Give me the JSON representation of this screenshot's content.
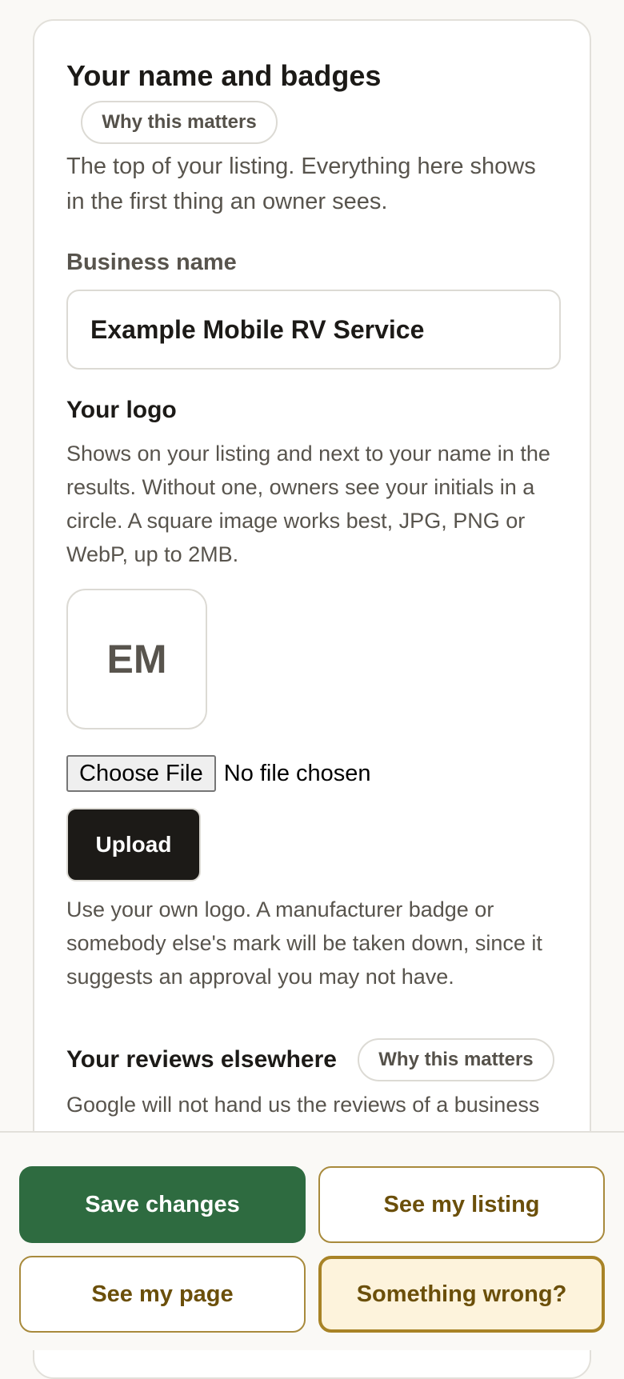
{
  "identity": {
    "title": "Your name and badges",
    "why_label": "Why this matters",
    "intro": "The top of your listing. Everything here shows in the first thing an owner sees."
  },
  "business_name": {
    "label": "Business name",
    "value": "Example Mobile RV Service"
  },
  "logo": {
    "title": "Your logo",
    "description": "Shows on your listing and next to your name in the results. Without one, owners see your initials in a circle. A square image works best, JPG, PNG or WebP, up to 2MB.",
    "initials": "EM",
    "choose_file_label": "Choose File",
    "no_file_text": "No file chosen",
    "upload_label": "Upload",
    "note": "Use your own logo. A manufacturer badge or somebody else's mark will be taken down, since it suggests an approval you may not have."
  },
  "reviews": {
    "title": "Your reviews elsewhere",
    "why_label": "Why this matters",
    "description": "Google will not hand us the reviews of a business"
  },
  "actions": {
    "save_label": "Save changes",
    "see_listing_label": "See my listing",
    "see_page_label": "See my page",
    "something_wrong_label": "Something wrong?"
  },
  "colors": {
    "save_button": "#2e6b40",
    "outline_button_text": "#6b4f0a",
    "outline_button_border": "#a88a3c",
    "warning_button_bg": "#fdf3dc",
    "upload_button": "#1c1a17"
  }
}
